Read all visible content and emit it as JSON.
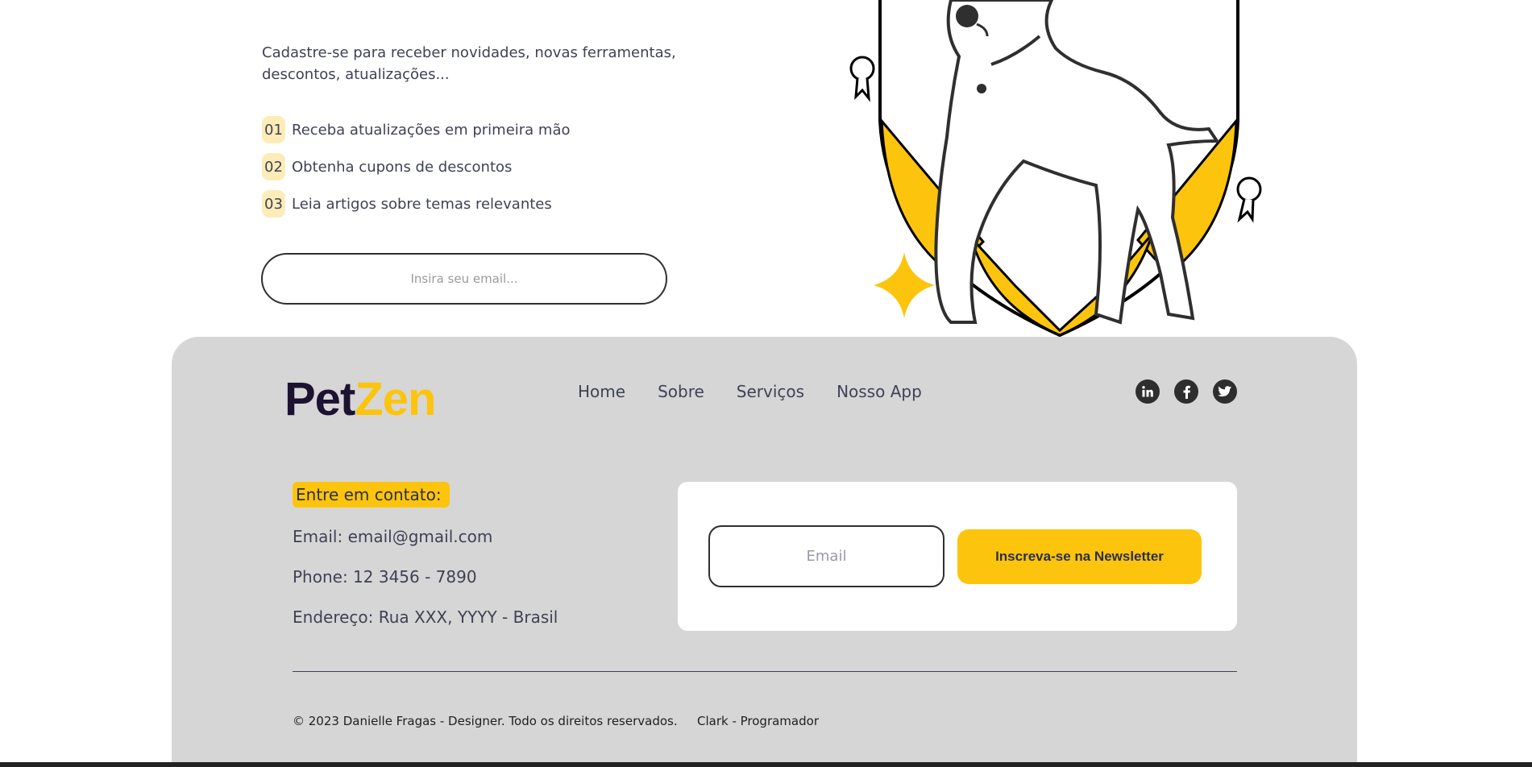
{
  "newsletter": {
    "intro": "Cadastre-se para receber novidades, novas ferramentas, descontos, atualizações...",
    "benefits": [
      {
        "num": "01",
        "text": "Receba atualizações em primeira mão"
      },
      {
        "num": "02",
        "text": "Obtenha cupons de descontos"
      },
      {
        "num": "03",
        "text": "Leia artigos sobre temas relevantes"
      }
    ],
    "email_placeholder": "Insira seu email..."
  },
  "footer": {
    "logo": {
      "part1": "Pet",
      "part2": "Zen"
    },
    "nav": [
      "Home",
      "Sobre",
      "Serviços",
      "Nosso App"
    ],
    "socials": [
      "linkedin-icon",
      "facebook-icon",
      "twitter-icon"
    ],
    "contact": {
      "title": "Entre em contato:",
      "email": "Email: email@gmail.com",
      "phone": "Phone: 12 3456 - 7890",
      "address": "Endereço: Rua XXX, YYYY - Brasil"
    },
    "newsletter_card": {
      "email_placeholder": "Email",
      "button_label": "Inscreva-se na Newsletter"
    },
    "copyright": "© 2023 Danielle Fragas - Designer. Todo os direitos reservados.",
    "credit": "Clark - Programador"
  },
  "colors": {
    "accent": "#fcc40d",
    "footer_bg": "#d6d6d6",
    "logo_dark": "#1d1232",
    "benefit_badge": "#fdecb8"
  }
}
